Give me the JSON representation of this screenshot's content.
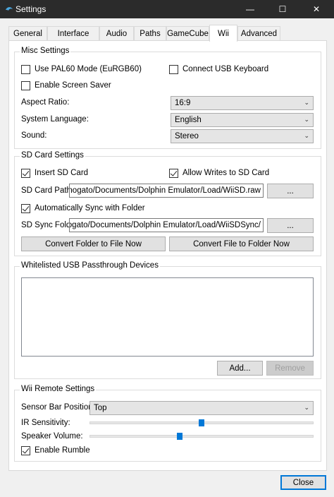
{
  "window": {
    "title": "Settings",
    "accent": "#0078d7"
  },
  "tabs": [
    {
      "label": "General"
    },
    {
      "label": "Interface"
    },
    {
      "label": "Audio"
    },
    {
      "label": "Paths"
    },
    {
      "label": "GameCube"
    },
    {
      "label": "Wii"
    },
    {
      "label": "Advanced"
    }
  ],
  "active_tab": "Wii",
  "misc": {
    "title": "Misc Settings",
    "pal60": {
      "label": "Use PAL60 Mode (EuRGB60)",
      "checked": false
    },
    "usb_keyboard": {
      "label": "Connect USB Keyboard",
      "checked": false
    },
    "screensaver": {
      "label": "Enable Screen Saver",
      "checked": false
    },
    "aspect_label": "Aspect Ratio:",
    "aspect_value": "16:9",
    "language_label": "System Language:",
    "language_value": "English",
    "sound_label": "Sound:",
    "sound_value": "Stereo"
  },
  "sd": {
    "title": "SD Card Settings",
    "insert": {
      "label": "Insert SD Card",
      "checked": true
    },
    "allow_writes": {
      "label": "Allow Writes to SD Card",
      "checked": true
    },
    "path_label": "SD Card Path:",
    "path_value": "C:/Users/Monogato/Documents/Dolphin Emulator/Load/WiiSD.raw",
    "browse1": "...",
    "autosync": {
      "label": "Automatically Sync with Folder",
      "checked": true
    },
    "sync_label": "SD Sync Folder:",
    "sync_value": "C:/Users/Monogato/Documents/Dolphin Emulator/Load/WiiSDSync/",
    "browse2": "...",
    "convert_folder": "Convert Folder to File Now",
    "convert_file": "Convert File to Folder Now"
  },
  "usb": {
    "title": "Whitelisted USB Passthrough Devices",
    "add": "Add...",
    "remove": "Remove"
  },
  "remote": {
    "title": "Wii Remote Settings",
    "sensor_label": "Sensor Bar Position:",
    "sensor_value": "Top",
    "ir_label": "IR Sensitivity:",
    "ir_value": 0.5,
    "volume_label": "Speaker Volume:",
    "volume_value": 0.4,
    "rumble": {
      "label": "Enable Rumble",
      "checked": true
    }
  },
  "close": "Close"
}
